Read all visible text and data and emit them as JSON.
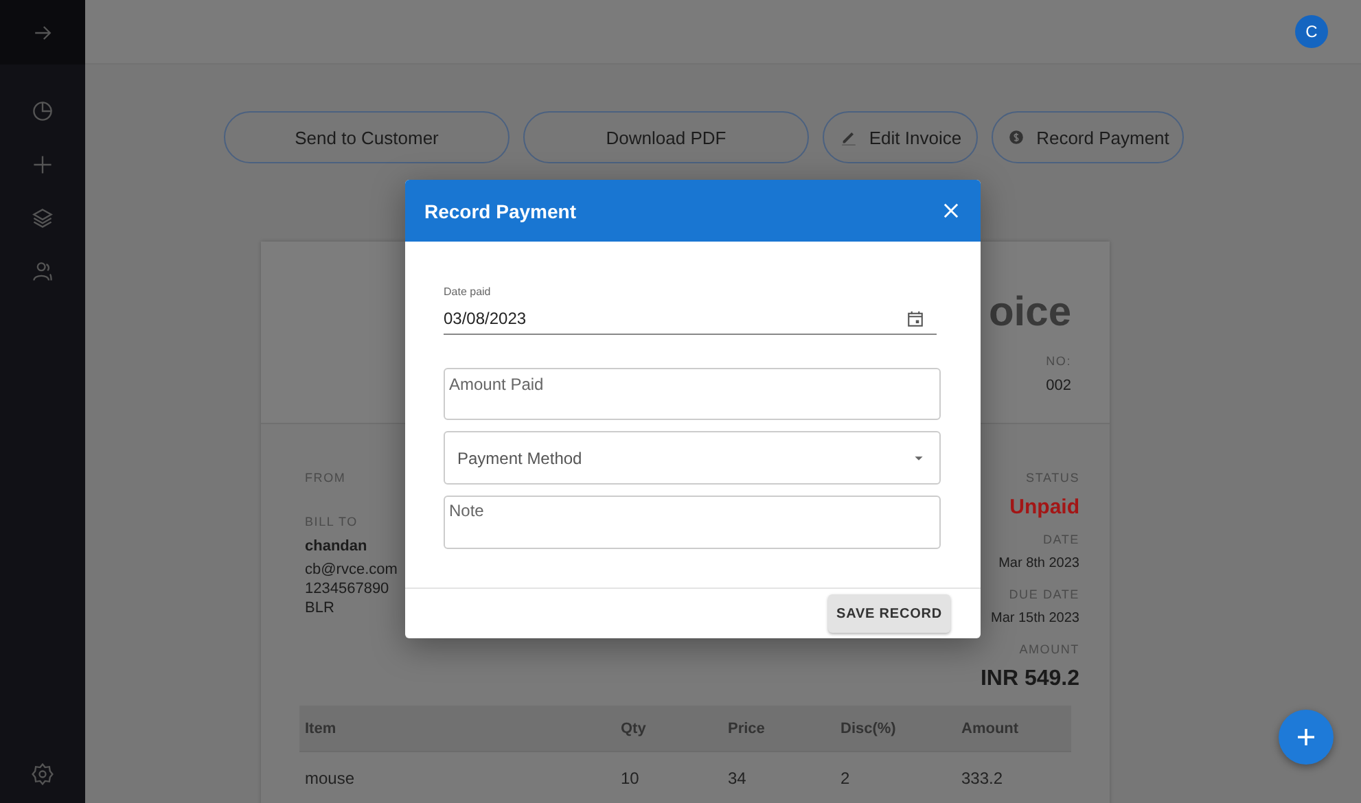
{
  "header": {
    "avatar": "C"
  },
  "actions": [
    {
      "label": "Send to Customer",
      "kind": "plain"
    },
    {
      "label": "Download PDF",
      "kind": "plain"
    },
    {
      "label": "Edit Invoice",
      "kind": "edit"
    },
    {
      "label": "Record Payment",
      "kind": "payment"
    }
  ],
  "invoice": {
    "title": "oice",
    "number_label": "NO:",
    "number": "002",
    "from_label": "FROM",
    "bill_to_label": "BILL TO",
    "customer": {
      "name": "chandan",
      "email": "cb@rvce.com",
      "phone": "1234567890",
      "address": "BLR"
    },
    "status_label": "STATUS",
    "status": "Unpaid",
    "date_label": "DATE",
    "date": "Mar 8th 2023",
    "due_label": "DUE DATE",
    "due": "Mar 15th 2023",
    "amount_label": "AMOUNT",
    "amount": "INR 549.2",
    "table": {
      "columns": [
        "Item",
        "Qty",
        "Price",
        "Disc(%)",
        "Amount"
      ],
      "rows": [
        [
          "mouse",
          "10",
          "34",
          "2",
          "333.2"
        ]
      ]
    }
  },
  "dialog": {
    "title": "Record Payment",
    "fields": [
      {
        "kind": "date",
        "label": "Date paid",
        "value": "03/08/2023"
      },
      {
        "kind": "text",
        "placeholder": "Amount Paid"
      },
      {
        "kind": "select",
        "placeholder": "Payment Method"
      },
      {
        "kind": "textarea",
        "placeholder": "Note"
      }
    ],
    "button": "SAVE RECORD"
  }
}
